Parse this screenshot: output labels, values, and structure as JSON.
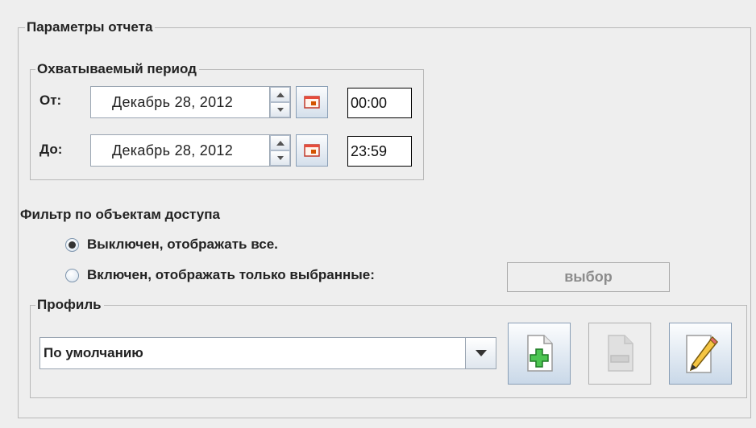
{
  "report": {
    "title": "Параметры отчета",
    "period": {
      "title": "Охватываемый период",
      "from_label": "От:",
      "from_date": "Декабрь 28, 2012",
      "from_time": "00:00",
      "to_label": "До:",
      "to_date": "Декабрь 28, 2012",
      "to_time": "23:59"
    },
    "filter": {
      "title": "Фильтр по объектам доступа",
      "option_off": "Выключен, отображать все.",
      "option_on": "Включен, отображать только выбранные:",
      "selected": "off",
      "select_button": "выбор"
    },
    "profile": {
      "title": "Профиль",
      "selected": "По умолчанию",
      "add_icon": "add-document-icon",
      "remove_icon": "remove-document-icon",
      "edit_icon": "pencil-icon"
    }
  },
  "colors": {
    "background": "#eeeeee",
    "border": "#b8b8b8",
    "add_green": "#3cb043",
    "disabled_text": "#8c8c8c"
  }
}
